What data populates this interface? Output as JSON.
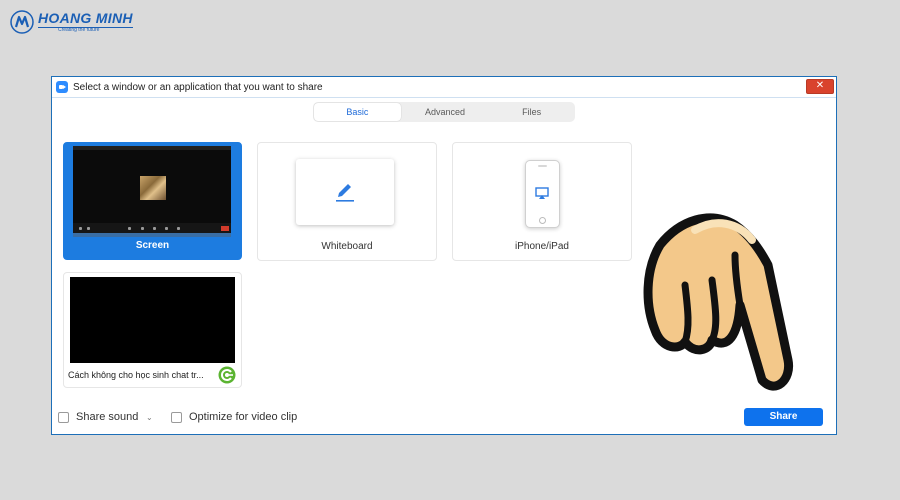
{
  "logo": {
    "name": "HOANG MINH",
    "tagline": "Creating the future"
  },
  "window": {
    "title": "Select a window or an application that you want to share",
    "close_symbol": "✕"
  },
  "tabs": [
    {
      "label": "Basic",
      "active": true
    },
    {
      "label": "Advanced",
      "active": false
    },
    {
      "label": "Files",
      "active": false
    }
  ],
  "sources": {
    "screen": {
      "label": "Screen",
      "selected": true
    },
    "whiteboard": {
      "label": "Whiteboard",
      "icon": "pencil-icon"
    },
    "iphone": {
      "label": "iPhone/iPad",
      "icon": "airplay-icon"
    },
    "browser_window": {
      "label": "Cách không cho học sinh chat tr...",
      "icon": "coccoc-browser-icon"
    }
  },
  "options": {
    "share_sound": {
      "label": "Share sound",
      "checked": false
    },
    "optimize": {
      "label": "Optimize for video clip",
      "checked": false
    }
  },
  "share_button": {
    "label": "Share"
  },
  "colors": {
    "accent": "#0e72ed",
    "selected_card": "#1d7ce0",
    "close": "#d9432d",
    "logo": "#1b5fb5",
    "hand_skin": "#f3c88a"
  }
}
